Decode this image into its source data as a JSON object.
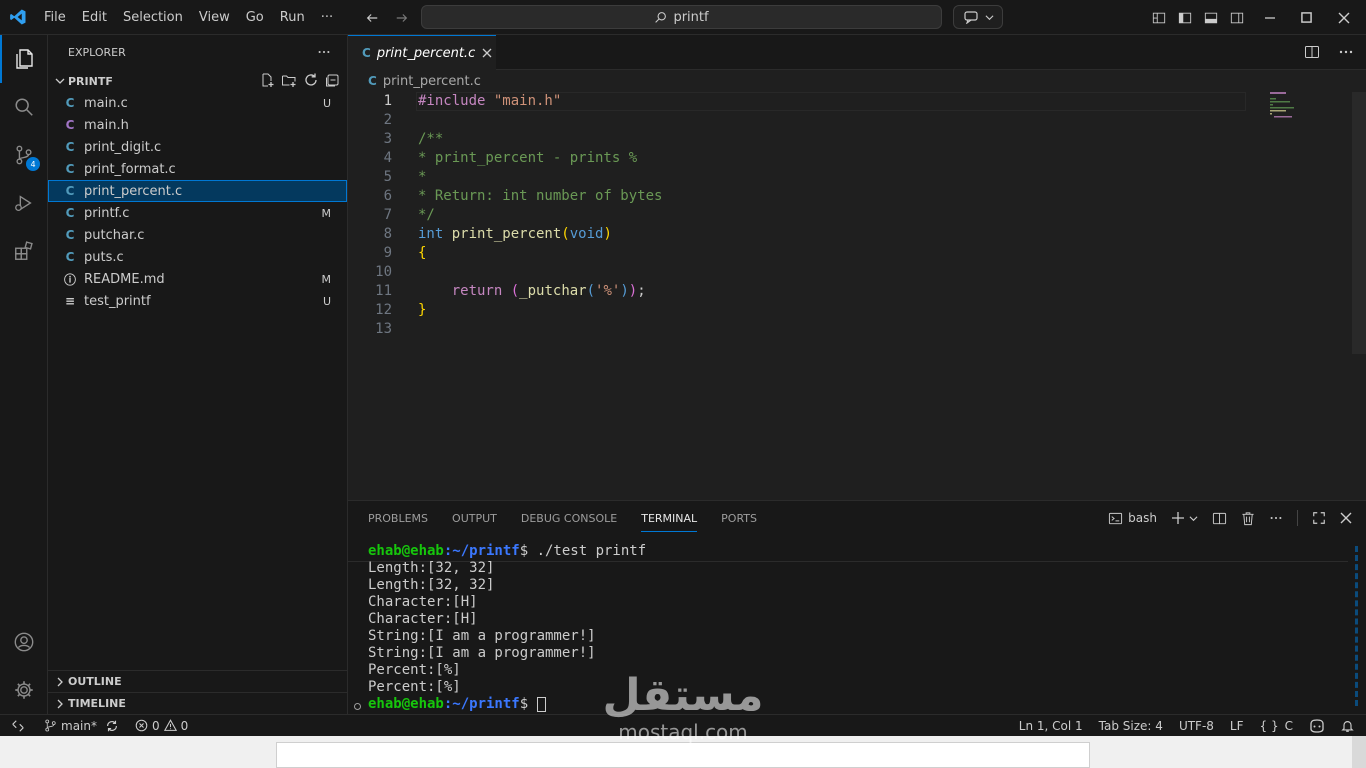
{
  "menu": [
    "File",
    "Edit",
    "Selection",
    "View",
    "Go",
    "Run",
    "···"
  ],
  "search": {
    "text": "printf"
  },
  "activity": {
    "scm_badge": "4"
  },
  "explorer": {
    "title": "EXPLORER",
    "folder": "PRINTF",
    "files": [
      {
        "name": "main.c",
        "icon": "C",
        "kind": "c",
        "status": "U"
      },
      {
        "name": "main.h",
        "icon": "C",
        "kind": "h",
        "status": ""
      },
      {
        "name": "print_digit.c",
        "icon": "C",
        "kind": "c",
        "status": ""
      },
      {
        "name": "print_format.c",
        "icon": "C",
        "kind": "c",
        "status": ""
      },
      {
        "name": "print_percent.c",
        "icon": "C",
        "kind": "c",
        "status": "",
        "selected": true
      },
      {
        "name": "printf.c",
        "icon": "C",
        "kind": "c",
        "status": "M"
      },
      {
        "name": "putchar.c",
        "icon": "C",
        "kind": "c",
        "status": ""
      },
      {
        "name": "puts.c",
        "icon": "C",
        "kind": "c",
        "status": ""
      },
      {
        "name": "README.md",
        "icon": "ⓘ",
        "kind": "info",
        "status": "M"
      },
      {
        "name": "test_printf",
        "icon": "≡",
        "kind": "info",
        "status": "U"
      }
    ],
    "outline": "OUTLINE",
    "timeline": "TIMELINE"
  },
  "editor": {
    "tab": "print_percent.c",
    "tab_icon": "C",
    "breadcrumb": "print_percent.c",
    "current_line": 1,
    "lines": [
      {
        "n": "1",
        "parts": [
          {
            "c": "kw-inc",
            "t": "#include "
          },
          {
            "c": "str",
            "t": "\"main.h\""
          }
        ]
      },
      {
        "n": "2",
        "parts": []
      },
      {
        "n": "3",
        "parts": [
          {
            "c": "cm",
            "t": "/**"
          }
        ]
      },
      {
        "n": "4",
        "parts": [
          {
            "c": "cm",
            "t": "* print_percent - prints %"
          }
        ]
      },
      {
        "n": "5",
        "parts": [
          {
            "c": "cm",
            "t": "*"
          }
        ]
      },
      {
        "n": "6",
        "parts": [
          {
            "c": "cm",
            "t": "* Return: int number of bytes"
          }
        ]
      },
      {
        "n": "7",
        "parts": [
          {
            "c": "cm",
            "t": "*/"
          }
        ]
      },
      {
        "n": "8",
        "parts": [
          {
            "c": "ty",
            "t": "int "
          },
          {
            "c": "fn",
            "t": "print_percent"
          },
          {
            "c": "br",
            "t": "("
          },
          {
            "c": "ty",
            "t": "void"
          },
          {
            "c": "br",
            "t": ")"
          }
        ]
      },
      {
        "n": "9",
        "parts": [
          {
            "c": "br",
            "t": "{"
          }
        ]
      },
      {
        "n": "10",
        "parts": []
      },
      {
        "n": "11",
        "parts": [
          {
            "c": "",
            "t": "    "
          },
          {
            "c": "ret",
            "t": "return "
          },
          {
            "c": "br2",
            "t": "("
          },
          {
            "c": "fn",
            "t": "_putchar"
          },
          {
            "c": "ty",
            "t": "("
          },
          {
            "c": "str",
            "t": "'%'"
          },
          {
            "c": "ty",
            "t": ")"
          },
          {
            "c": "br2",
            "t": ")"
          },
          {
            "c": "",
            "t": ";"
          }
        ]
      },
      {
        "n": "12",
        "parts": [
          {
            "c": "br",
            "t": "}"
          }
        ]
      },
      {
        "n": "13",
        "parts": []
      }
    ]
  },
  "panel": {
    "tabs": [
      "PROBLEMS",
      "OUTPUT",
      "DEBUG CONSOLE",
      "TERMINAL",
      "PORTS"
    ],
    "active_tab": "TERMINAL",
    "shell": "bash",
    "prompt_user": "ehab@ehab",
    "prompt_path": ":~/printf",
    "prompt_sign": "$ ",
    "command": "./test printf",
    "output": [
      "Length:[32, 32]",
      "Length:[32, 32]",
      "Character:[H]",
      "Character:[H]",
      "String:[I am a programmer!]",
      "String:[I am a programmer!]",
      "Percent:[%]",
      "Percent:[%]"
    ]
  },
  "status": {
    "branch": "main*",
    "errors": "0",
    "warnings": "0",
    "position": "Ln 1, Col 1",
    "tab_size": "Tab Size: 4",
    "encoding": "UTF-8",
    "eol": "LF",
    "language": "C"
  },
  "watermark": {
    "arabic": "مستقل",
    "latin": "mostaql.com"
  },
  "colors": {
    "accent": "#0078d4",
    "background": "#181818",
    "editor_bg": "#1f1f1f"
  }
}
